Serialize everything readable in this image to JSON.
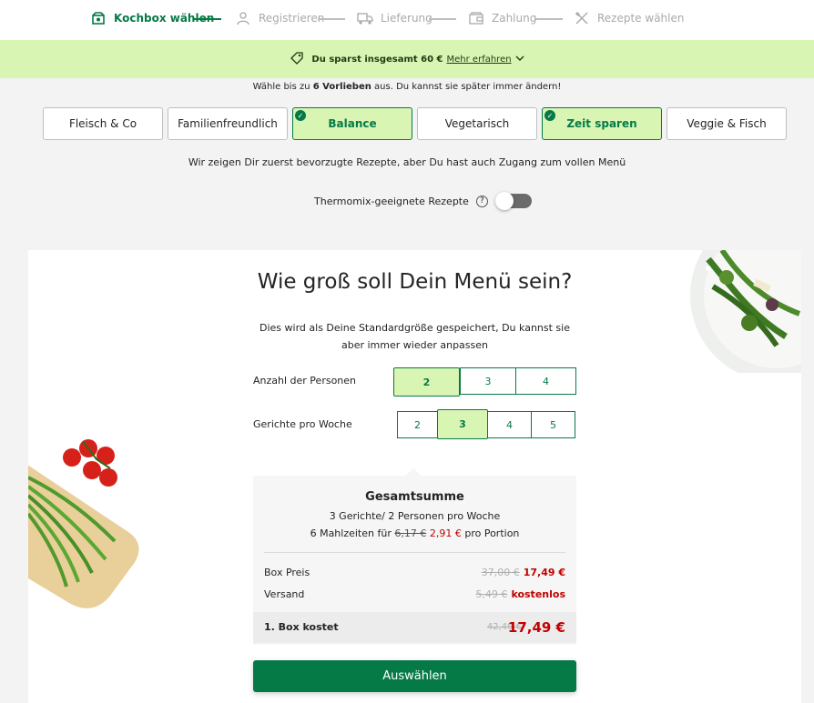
{
  "stepper": {
    "steps": [
      {
        "label": "Kochbox wählen",
        "icon": "box-icon"
      },
      {
        "label": "Registrieren",
        "icon": "user-icon"
      },
      {
        "label": "Lieferung",
        "icon": "truck-icon"
      },
      {
        "label": "Zahlung",
        "icon": "wallet-icon"
      },
      {
        "label": "Rezepte wählen",
        "icon": "cutlery-icon"
      }
    ]
  },
  "promo": {
    "text": "Du sparst insgesamt 60 €",
    "link": "Mehr erfahren"
  },
  "preferences": {
    "hint_prefix": "Wähle bis zu ",
    "hint_bold": "6 Vorlieben",
    "hint_suffix": " aus. Du kannst sie später immer ändern!",
    "items": [
      {
        "label": "Fleisch & Co",
        "selected": false
      },
      {
        "label": "Familienfreundlich",
        "selected": false
      },
      {
        "label": "Balance",
        "selected": true
      },
      {
        "label": "Vegetarisch",
        "selected": false
      },
      {
        "label": "Zeit sparen",
        "selected": true
      },
      {
        "label": "Veggie & Fisch",
        "selected": false
      }
    ],
    "subhint": "Wir zeigen Dir zuerst bevorzugte Rezepte, aber Du hast auch Zugang zum vollen Menü"
  },
  "thermomix": {
    "label": "Thermomix-geeignete Rezepte",
    "help": "?",
    "enabled": false
  },
  "menu": {
    "title": "Wie groß soll Dein Menü sein?",
    "description": "Dies wird als Deine Standardgröße gespeichert, Du kannst sie aber immer wieder anpassen",
    "persons": {
      "label": "Anzahl der Personen",
      "options": [
        "2",
        "3",
        "4"
      ],
      "selected": "2"
    },
    "meals": {
      "label": "Gerichte pro Woche",
      "options": [
        "2",
        "3",
        "4",
        "5"
      ],
      "selected": "3"
    }
  },
  "summary": {
    "title": "Gesamtsumme",
    "line1": "3 Gerichte/ 2 Personen pro Woche",
    "line2_prefix": "6 Mahlzeiten für ",
    "line2_old": "6,17 €",
    "line2_new": "2,91 €",
    "line2_suffix": " pro Portion",
    "box_label": "Box Preis",
    "box_old": "37,00 €",
    "box_new": "17,49 €",
    "shipping_label": "Versand",
    "shipping_old": "5,49 €",
    "shipping_new": "kostenlos",
    "total_label": "1. Box kostet",
    "total_old": "42,49 €",
    "total_new": "17,49 €"
  },
  "cta": {
    "label": "Auswählen"
  },
  "colors": {
    "brand": "#067a46",
    "accent": "#d8f5b4",
    "price": "#c20000"
  }
}
